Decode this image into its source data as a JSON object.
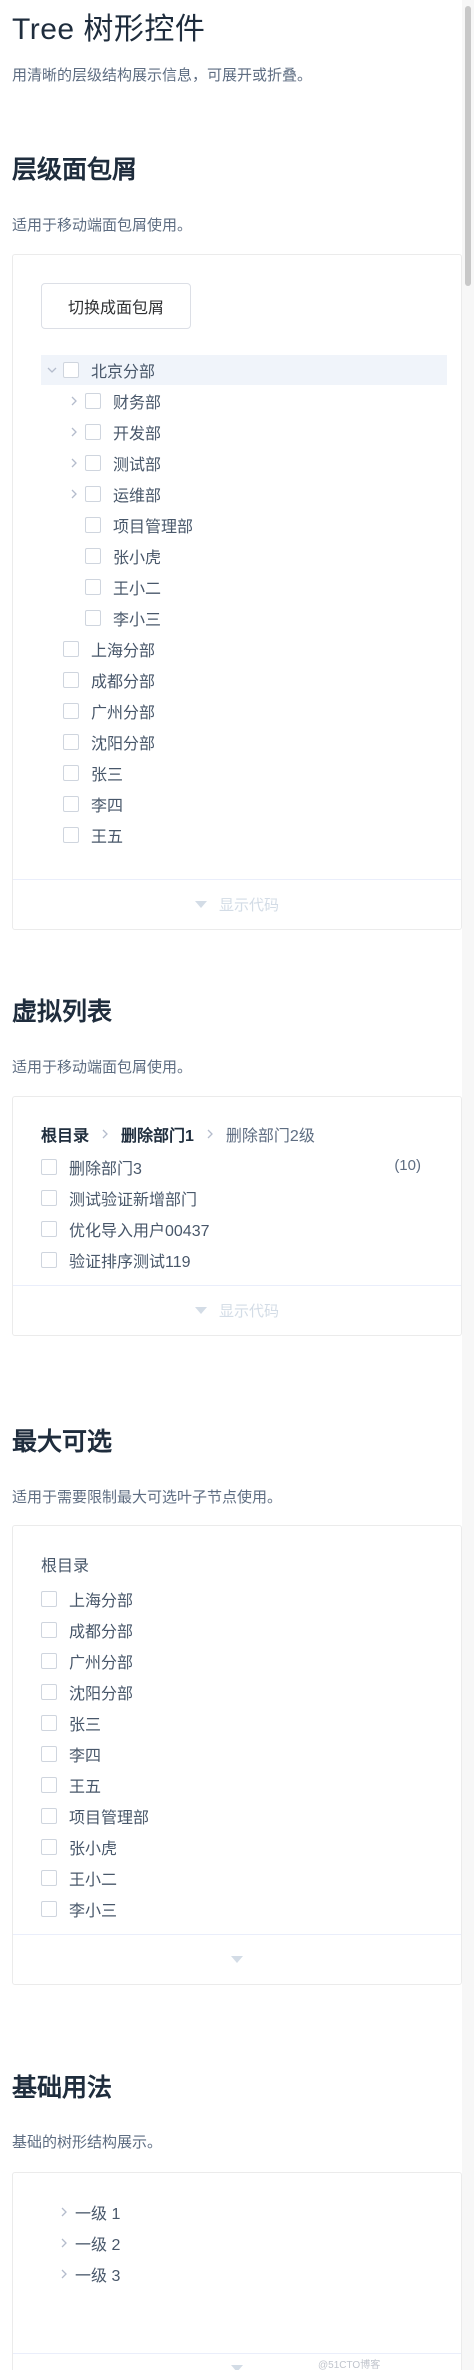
{
  "page": {
    "title": "Tree 树形控件",
    "desc": "用清晰的层级结构展示信息，可展开或折叠。"
  },
  "sections": {
    "breadcrumb": {
      "title": "层级面包屑",
      "desc": "适用于移动端面包屑使用。",
      "button": "切换成面包屑",
      "root": "北京分部",
      "children": [
        "财务部",
        "开发部",
        "测试部",
        "运维部"
      ],
      "leaves": [
        "项目管理部",
        "张小虎",
        "王小二",
        "李小三"
      ],
      "siblings": [
        "上海分部",
        "成都分部",
        "广州分部",
        "沈阳分部",
        "张三",
        "李四",
        "王五"
      ],
      "footer": "显示代码"
    },
    "virtual": {
      "title": "虚拟列表",
      "desc": "适用于移动端面包屑使用。",
      "crumbs": [
        "根目录",
        "删除部门1",
        "删除部门2级"
      ],
      "items": [
        "删除部门3",
        "测试验证新增部门",
        "优化导入用户00437",
        "验证排序测试119"
      ],
      "count": "(10)",
      "footer": "显示代码"
    },
    "max": {
      "title": "最大可选",
      "desc": "适用于需要限制最大可选叶子节点使用。",
      "root": "根目录",
      "items": [
        "上海分部",
        "成都分部",
        "广州分部",
        "沈阳分部",
        "张三",
        "李四",
        "王五",
        "项目管理部",
        "张小虎",
        "王小二",
        "李小三"
      ]
    },
    "basic": {
      "title": "基础用法",
      "desc": "基础的树形结构展示。",
      "items": [
        "一级 1",
        "一级 2",
        "一级 3"
      ]
    }
  },
  "watermark": "@51CTO博客"
}
